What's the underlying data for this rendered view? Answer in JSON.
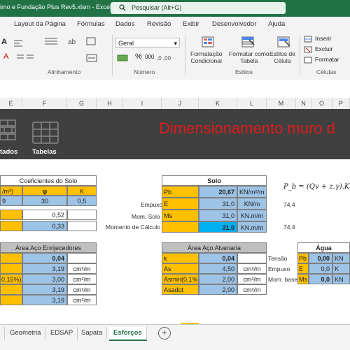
{
  "window": {
    "title": "imo e Fundação Plus Rev5.xlsm  -  Excel",
    "search_placeholder": "Pesquisar (Alt+G)"
  },
  "ribbon_tabs": [
    "Layout da Página",
    "Fórmulas",
    "Dados",
    "Revisão",
    "Exibir",
    "Desenvolvedor",
    "Ajuda"
  ],
  "ribbon": {
    "alignment_group": "Alinhamento",
    "number_group": "Número",
    "number_format": "Geral",
    "percent": "%",
    "thousands": "000",
    "styles_group": "Estilos",
    "cond_format": "Formatação\nCondicional",
    "format_table": "Formatar como\nTabela",
    "cell_styles": "Estilos de\nCélula",
    "cells_group": "Células",
    "insert": "Inserir",
    "delete": "Excluir",
    "format": "Formatar"
  },
  "columns": [
    "E",
    "F",
    "G",
    "H",
    "I",
    "J",
    "K",
    "L",
    "M",
    "N",
    "O",
    "P"
  ],
  "banner": {
    "title": "Dimensionamento muro d",
    "left_label": "tados",
    "tables_label": "Tabelas"
  },
  "coef_table": {
    "header": "Coeficientes  do Solo",
    "col_labels": [
      "/m³)",
      "φ",
      "K"
    ],
    "row1": [
      "9",
      "30",
      "0,5"
    ],
    "row2_value": "0,52",
    "row3_value": "0,33"
  },
  "solo_table": {
    "header": "Solo",
    "rows": [
      {
        "outer": "",
        "key": "Pb",
        "value": "20,67",
        "unit": "KN/m²/m"
      },
      {
        "outer": "Empuxo",
        "key": "E",
        "value": "31,0",
        "unit": "KN/m"
      },
      {
        "outer": "Mom. Solo",
        "key": "Ms",
        "value": "31,0",
        "unit": "KN.m/m"
      },
      {
        "outer": "Momento de Cálculo",
        "key": "",
        "value": "31,0",
        "unit": "KN.m/m"
      }
    ],
    "right_values": [
      "74,4",
      "74,4"
    ]
  },
  "formula": "P_b = (Qv + z.γ).Ka −",
  "area_enrij": {
    "header": "Área Aço Enrijecedores",
    "left_label": "0,15%)",
    "rows": [
      {
        "value": "0,04",
        "unit": ""
      },
      {
        "value": "3,19",
        "unit": "cm²/m"
      },
      {
        "value": "3,00",
        "unit": "cm²/m"
      },
      {
        "value": "3,19",
        "unit": "cm²/m"
      },
      {
        "value": "3,19",
        "unit": "cm²/m"
      }
    ]
  },
  "area_alv": {
    "header": "Área Aço Alvenaria",
    "rows": [
      {
        "key": "k",
        "value": "0,04",
        "unit": ""
      },
      {
        "key": "As",
        "value": "4,50",
        "unit": "cm²/m"
      },
      {
        "key": "Asmin(0,1%",
        "value": "2,00",
        "unit": "cm²/m"
      },
      {
        "key": "Asadot",
        "value": "2,00",
        "unit": "cm²/m"
      }
    ],
    "side_labels": [
      "Tensão",
      "Empuxo",
      "Mom. base"
    ]
  },
  "agua": {
    "header": "Água",
    "rows": [
      {
        "key": "Pb",
        "value": "0,00",
        "unit": "KN"
      },
      {
        "key": "E",
        "value": "0,0",
        "unit": "K"
      },
      {
        "key": "Ms",
        "value": "0,0",
        "unit": "KN"
      }
    ]
  },
  "sheet_tabs": [
    "Geometria",
    "EDSAP",
    "Sapata",
    "Esforços"
  ],
  "active_sheet": "Esforços",
  "add_sheet": "+"
}
